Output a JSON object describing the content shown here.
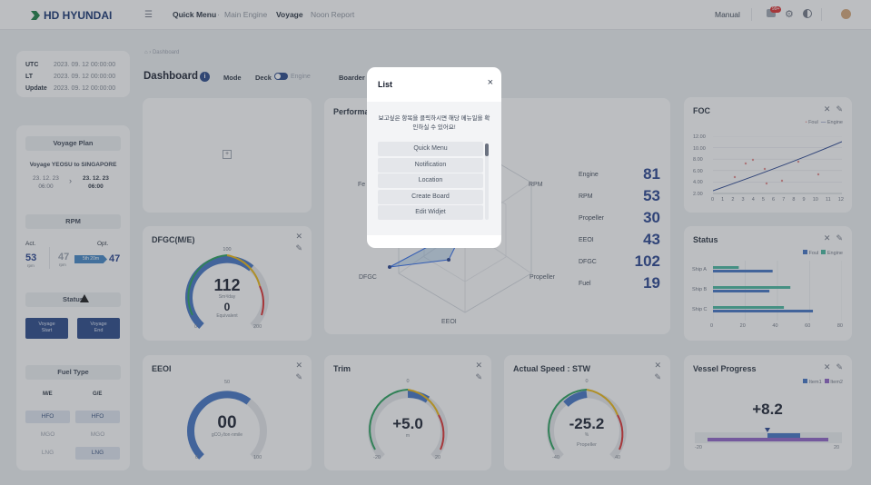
{
  "topbar": {
    "brand": "HD HYUNDAI",
    "nav": [
      "Quick Menu",
      "Main Engine",
      "Voyage",
      "Noon Report"
    ],
    "sep": "·",
    "mode": "Manual",
    "badge": "99+"
  },
  "time": {
    "rows": [
      {
        "k": "UTC",
        "v": "2023. 09. 12 00:00:00"
      },
      {
        "k": "LT",
        "v": "2023. 09. 12 00:00:00"
      },
      {
        "k": "Update",
        "v": "2023. 09. 12 00:00:00"
      }
    ]
  },
  "breadcrumb": "Dashboard",
  "dashboard": {
    "title": "Dashboard",
    "info_icon": "i",
    "mode_label": "Mode",
    "deck": "Deck",
    "engine": "Engine",
    "boarder": "Boarder"
  },
  "voyage": {
    "title": "Voyage Plan",
    "route": "Voyage YEOSU to SINGAPORE",
    "from_date": "23. 12. 23",
    "from_time": "06:00",
    "to_date": "23. 12. 23",
    "to_time": "06:00"
  },
  "rpm": {
    "title": "RPM",
    "act_label": "Act.",
    "opt_label": "Opt.",
    "act": "53",
    "act_unit": "rpm",
    "prev": "47",
    "prev_unit": "rpm",
    "change": "5th 20m",
    "opt": "47"
  },
  "status_panel": {
    "title": "Status",
    "start": "Voyage\nStart",
    "end": "Voyage\nEnd"
  },
  "fuel": {
    "title": "Fuel Type",
    "me": "M/E",
    "ge": "G/E",
    "rows": [
      [
        "HFO",
        "HFO"
      ],
      [
        "MGO",
        "MGO"
      ],
      [
        "LNG",
        "LNG"
      ]
    ],
    "active": [
      [
        true,
        true
      ],
      [
        false,
        false
      ],
      [
        false,
        true
      ]
    ]
  },
  "empty_card": {
    "plus": "+"
  },
  "performance": {
    "title": "Performance",
    "axes": [
      "RPM",
      "Propeller",
      "EEOI",
      "DFGC",
      "Fe"
    ],
    "metrics": [
      {
        "k": "Engine",
        "v": "81"
      },
      {
        "k": "RPM",
        "v": "53"
      },
      {
        "k": "Propeller",
        "v": "30"
      },
      {
        "k": "EEOI",
        "v": "43"
      },
      {
        "k": "DFGC",
        "v": "102"
      },
      {
        "k": "Fuel",
        "v": "19"
      }
    ]
  },
  "foc": {
    "title": "FOC",
    "legend": [
      "Foul",
      "Engine"
    ],
    "yticks": [
      "12.00",
      "10.00",
      "8.00",
      "6.00",
      "4.00",
      "2.00"
    ],
    "xticks": [
      "0",
      "1",
      "2",
      "3",
      "4",
      "5",
      "6",
      "7",
      "8",
      "9",
      "10",
      "11",
      "12"
    ]
  },
  "dfgc": {
    "title": "DFGC(M/E)",
    "value": "112",
    "unit": "Sm³/day",
    "sub": "0",
    "sub_unit": "Equivalent",
    "min": "0",
    "mid": "100",
    "max": "200",
    "fraction": 0.56
  },
  "status_chart": {
    "title": "Status",
    "legend": [
      "Foul",
      "Engine"
    ],
    "categories": [
      "Ship A",
      "Ship B",
      "Ship C"
    ],
    "xticks": [
      "0",
      "20",
      "40",
      "60",
      "80"
    ],
    "foul": [
      37,
      35,
      62
    ],
    "engine": [
      16,
      48,
      44
    ]
  },
  "eeoi": {
    "title": "EEOI",
    "value": "00",
    "unit": "gCO₂/ton·nmile",
    "min": "0",
    "mid": "50",
    "max": "100",
    "fraction": 0.55
  },
  "trim": {
    "title": "Trim",
    "value": "+5.0",
    "unit": "m",
    "min": "-20",
    "mid": "0",
    "max": "20"
  },
  "speed": {
    "title": "Actual Speed : STW",
    "value": "-25.2",
    "unit": "%",
    "sub": "Propeller",
    "min": "-40",
    "mid": "0",
    "max": "40"
  },
  "vessel": {
    "title": "Vessel Progress",
    "legend": [
      "Item1",
      "Item2"
    ],
    "value": "+8.2",
    "min": "-20",
    "max": "20"
  },
  "modal": {
    "title": "List",
    "close": "×",
    "desc": "보고싶은 항목을 클릭하시면 해당 메뉴일을 확인하실 수 있어요!",
    "items": [
      "Quick Menu",
      "Notification",
      "Location",
      "Create Board",
      "Edit Widjet"
    ]
  }
}
